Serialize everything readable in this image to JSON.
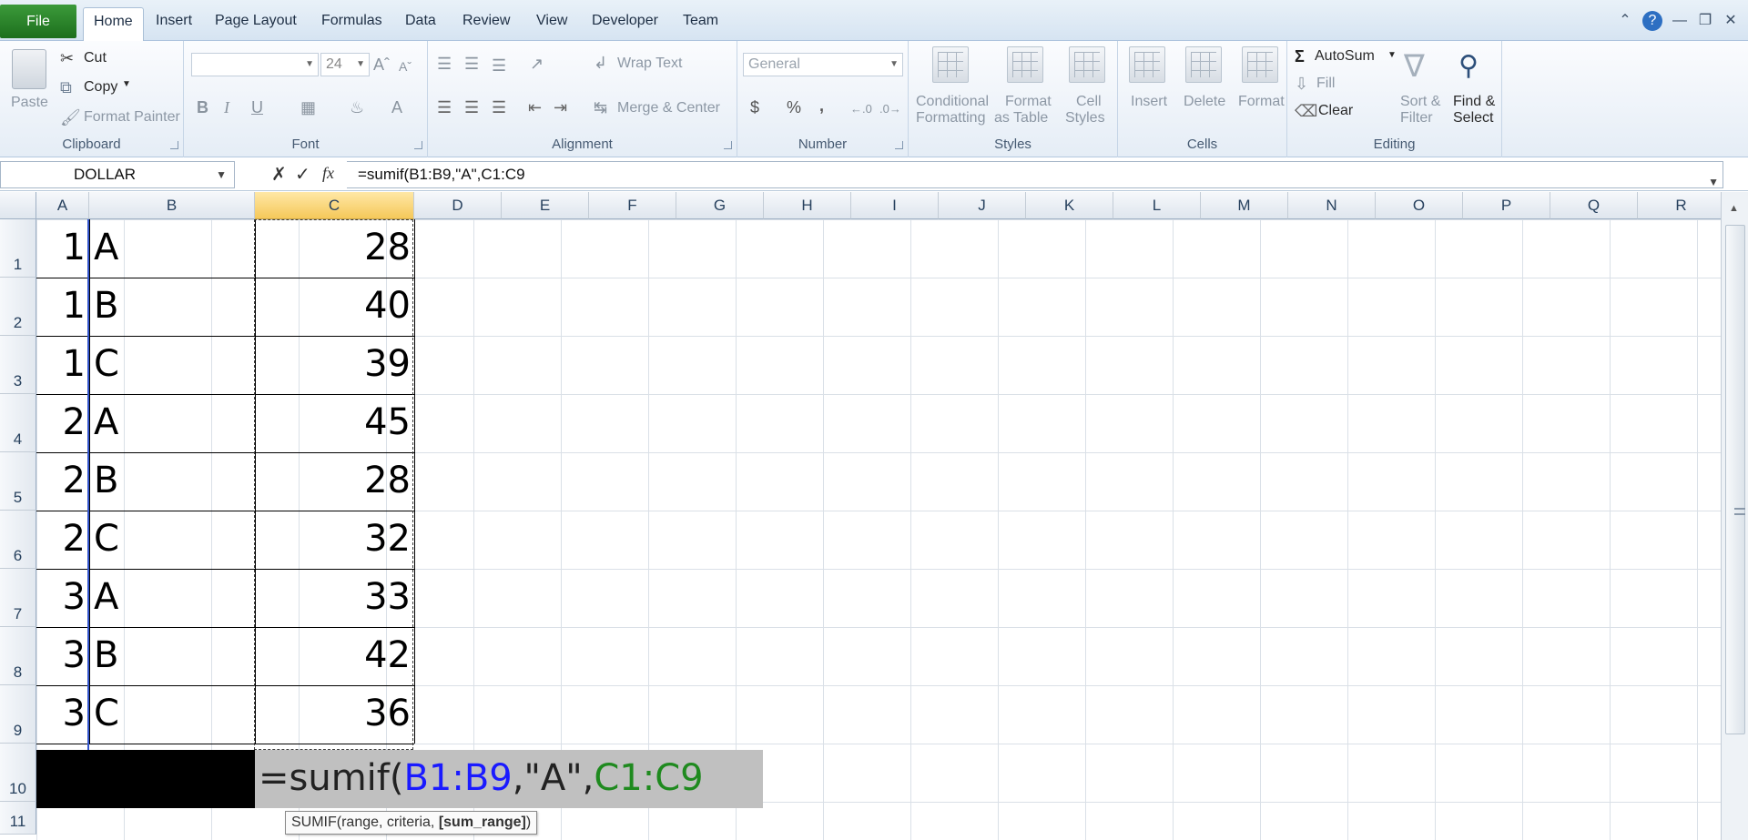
{
  "tabs": {
    "file": "File",
    "items": [
      "Home",
      "Insert",
      "Page Layout",
      "Formulas",
      "Data",
      "Review",
      "View",
      "Developer",
      "Team"
    ],
    "active": "Home"
  },
  "ribbon": {
    "clipboard": {
      "label": "Clipboard",
      "paste": "Paste",
      "cut": "Cut",
      "copy": "Copy",
      "format_painter": "Format Painter"
    },
    "font": {
      "label": "Font",
      "font_name": "",
      "font_size": "24",
      "bold": "B",
      "italic": "I",
      "underline": "U"
    },
    "alignment": {
      "label": "Alignment",
      "wrap_text": "Wrap Text",
      "merge_center": "Merge & Center"
    },
    "number": {
      "label": "Number",
      "format": "General",
      "currency": "$",
      "percent": "%",
      "comma": ",",
      "inc_decimal": ".00 +.0",
      "dec_decimal": ".00 ->.0"
    },
    "styles": {
      "label": "Styles",
      "conditional_l1": "Conditional",
      "conditional_l2": "Formatting",
      "format_table_l1": "Format",
      "format_table_l2": "as Table",
      "cell_styles_l1": "Cell",
      "cell_styles_l2": "Styles"
    },
    "cells": {
      "label": "Cells",
      "insert": "Insert",
      "delete": "Delete",
      "format": "Format"
    },
    "editing": {
      "label": "Editing",
      "autosum": "AutoSum",
      "fill": "Fill",
      "clear": "Clear",
      "sort_l1": "Sort &",
      "sort_l2": "Filter",
      "find_l1": "Find &",
      "find_l2": "Select"
    }
  },
  "formula_bar": {
    "name_box": "DOLLAR",
    "formula": "=sumif(B1:B9,\"A\",C1:C9"
  },
  "sheet": {
    "columns": [
      "A",
      "B",
      "C",
      "D",
      "E",
      "F",
      "G",
      "H",
      "I",
      "J",
      "K",
      "L",
      "M",
      "N",
      "O",
      "P",
      "Q",
      "R"
    ],
    "rows": [
      "1",
      "2",
      "3",
      "4",
      "5",
      "6",
      "7",
      "8",
      "9",
      "10",
      "11"
    ],
    "data": [
      {
        "a": "1",
        "b": "A",
        "c": "28"
      },
      {
        "a": "1",
        "b": "B",
        "c": "40"
      },
      {
        "a": "1",
        "c": "39",
        "b": "C"
      },
      {
        "a": "2",
        "b": "A",
        "c": "45"
      },
      {
        "a": "2",
        "b": "B",
        "c": "28"
      },
      {
        "a": "2",
        "b": "C",
        "c": "32"
      },
      {
        "a": "3",
        "b": "A",
        "c": "33"
      },
      {
        "a": "3",
        "b": "B",
        "c": "42"
      },
      {
        "a": "3",
        "b": "C",
        "c": "36"
      }
    ],
    "edit_cell": {
      "prefix": "=sumif(",
      "ref1": "B1:B9",
      "criteria": ",\"A\",",
      "ref2": "C1:C9"
    },
    "tooltip": {
      "func": "SUMIF(range, criteria, ",
      "bold_arg": "[sum_range]",
      "close": ")"
    }
  },
  "colors": {
    "ref1": "#1a1aff",
    "ref2": "#1f8a1f",
    "selected_header": "#f5c85a"
  }
}
